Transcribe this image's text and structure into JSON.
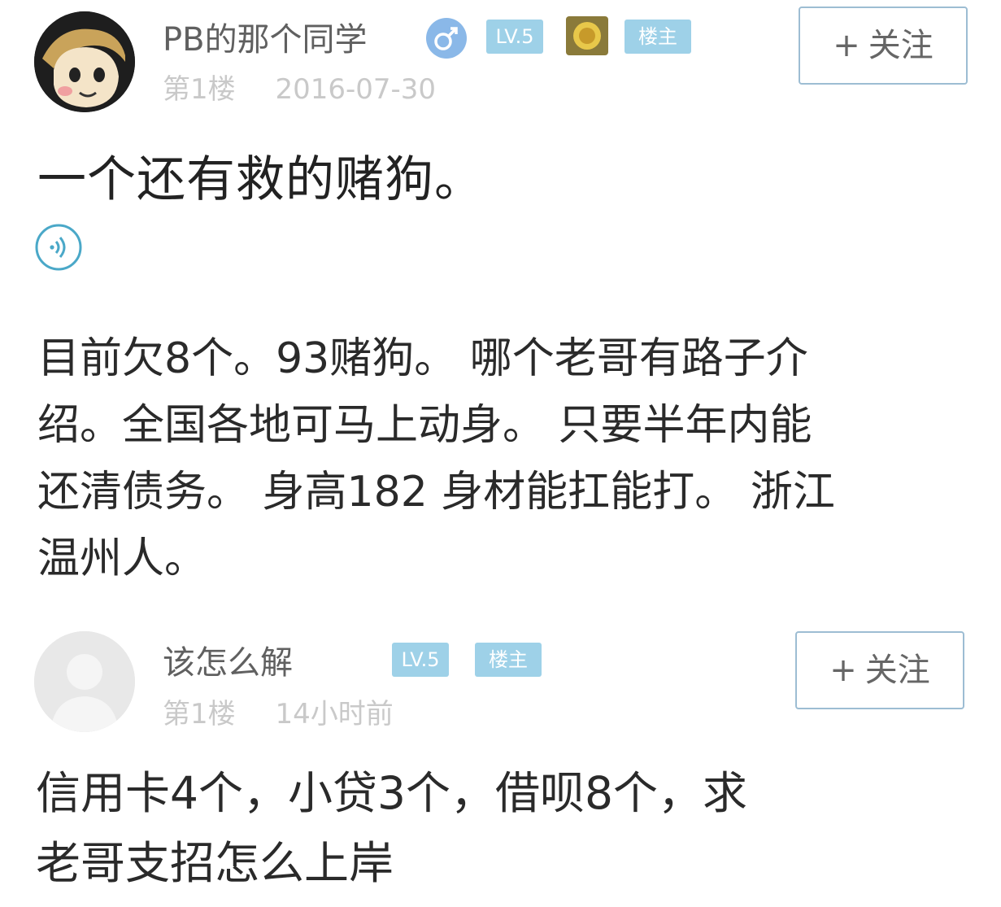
{
  "posts": [
    {
      "username": "PB的那个同学",
      "badges": {
        "level": "LV.5",
        "host": "楼主"
      },
      "floor": "第1楼",
      "time": "2016-07-30",
      "follow_label": "关注",
      "follow_plus": "+",
      "title": "一个还有救的赌狗。",
      "body_lines": [
        "目前欠8个。93赌狗。 哪个老哥有路子介",
        "绍。全国各地可马上动身。 只要半年内能",
        "还清债务。 身高182 身材能扛能打。 浙江",
        "温州人。"
      ],
      "icons": [
        "avatar-cartoon",
        "male-gender-icon",
        "medal-icon",
        "voice-play-icon"
      ]
    },
    {
      "username": "该怎么解",
      "badges": {
        "level": "LV.5",
        "host": "楼主"
      },
      "floor": "第1楼",
      "time": "14小时前",
      "follow_label": "关注",
      "follow_plus": "+",
      "body_lines": [
        "信用卡4个，小贷3个，借呗8个，求",
        "老哥支招怎么上岸"
      ],
      "icons": [
        "avatar-default"
      ]
    }
  ],
  "colors": {
    "badge": "#9ed1e8",
    "meta": "#c9c9c9",
    "button_border": "#9dbdd3"
  }
}
